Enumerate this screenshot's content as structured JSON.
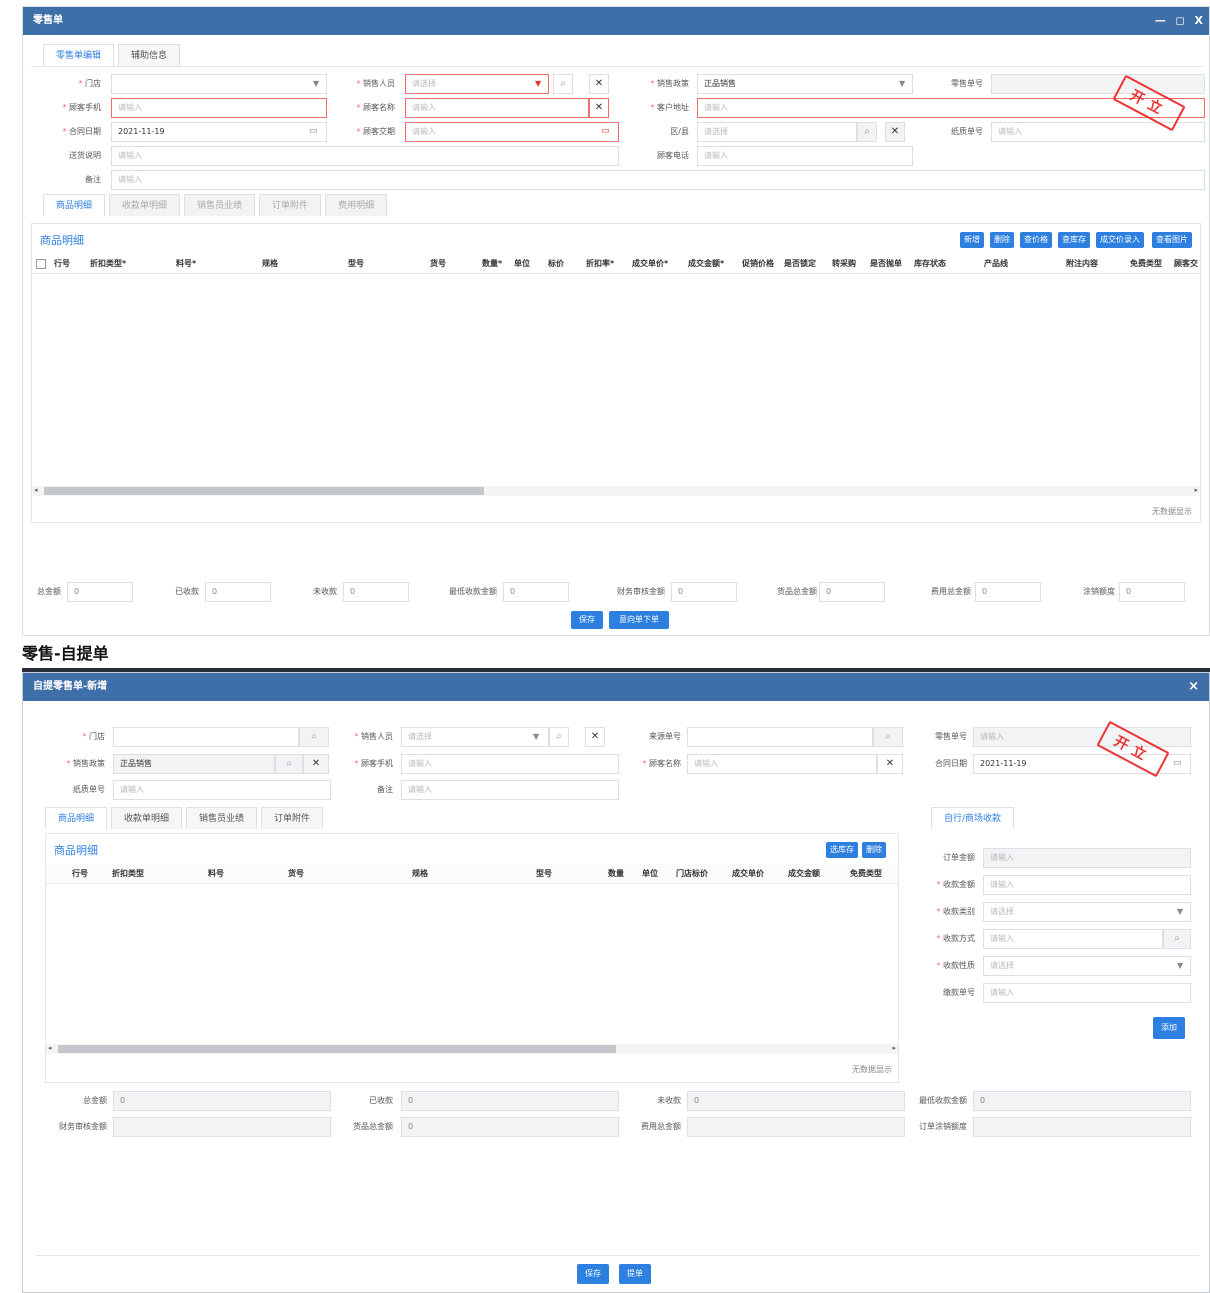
{
  "win1": {
    "title": "零售单",
    "controls": [
      "—",
      "◻",
      "X"
    ],
    "tabs": [
      "零售单编辑",
      "辅助信息"
    ],
    "form": {
      "store_label": "门店",
      "store_value": "",
      "salesperson_label": "销售人员",
      "salesperson_ph": "请选择",
      "policy_label": "销售政策",
      "policy_value": "正品销售",
      "order_no_label": "零售单号",
      "order_no_value": "",
      "phone_label": "顾客手机",
      "phone_ph": "请输入",
      "cust_name_label": "顾客名称",
      "cust_name_ph": "请输入",
      "addr_label": "客户地址",
      "addr_ph": "请输入",
      "contract_label": "合同日期",
      "contract_value": "2021-11-19",
      "delivery_label": "顾客交期",
      "delivery_ph": "请输入",
      "region_label": "区/县",
      "region_ph": "请选择",
      "paper_label": "纸质单号",
      "paper_ph": "请输入",
      "ship_label": "送货说明",
      "ship_ph": "请输入",
      "cphone_label": "顾客电话",
      "cphone_ph": "请输入",
      "remark_label": "备注",
      "remark_ph": "请输入"
    },
    "stamp": "开立",
    "subtabs": [
      "商品明细",
      "收款单明细",
      "销售员业绩",
      "订单附件",
      "费用明细"
    ],
    "section_title": "商品明细",
    "buttons": [
      "新增",
      "删除",
      "查价格",
      "查库存",
      "成交价录入",
      "查看图片"
    ],
    "columns": [
      "行号",
      "折扣类型*",
      "料号*",
      "规格",
      "型号",
      "货号",
      "数量*",
      "单位",
      "标价",
      "折扣率*",
      "成交单价*",
      "成交金额*",
      "促销价格",
      "是否锁定",
      "转采购",
      "是否抛单",
      "库存状态",
      "产品线",
      "附注内容",
      "免费类型",
      "顾客交"
    ],
    "no_data": "无数据显示",
    "summary": [
      {
        "label": "总金额",
        "value": "0"
      },
      {
        "label": "已收款",
        "value": "0"
      },
      {
        "label": "未收款",
        "value": "0"
      },
      {
        "label": "最低收款金额",
        "value": "0"
      },
      {
        "label": "财务审核金额",
        "value": "0"
      },
      {
        "label": "货品总金额",
        "value": "0"
      },
      {
        "label": "费用总金额",
        "value": "0"
      },
      {
        "label": "涂销额度",
        "value": "0"
      }
    ],
    "save": "保存",
    "submit": "意向单下单"
  },
  "heading": "零售-自提单",
  "win2": {
    "title": "自提零售单-新增",
    "close": "×",
    "form": {
      "store_label": "门店",
      "salesperson_label": "销售人员",
      "salesperson_ph": "请选择",
      "source_label": "来源单号",
      "order_no_label": "零售单号",
      "order_no_ph": "请输入",
      "policy_label": "销售政策",
      "policy_value": "正品销售",
      "phone_label": "顾客手机",
      "phone_ph": "请输入",
      "cust_name_label": "顾客名称",
      "cust_name_ph": "请输入",
      "contract_label": "合同日期",
      "contract_value": "2021-11-19",
      "paper_label": "纸质单号",
      "paper_ph": "请输入",
      "remark_label": "备注",
      "remark_ph": "请输入"
    },
    "stamp": "开立",
    "subtabs": [
      "商品明细",
      "收款单明细",
      "销售员业绩",
      "订单附件"
    ],
    "section_title": "商品明细",
    "buttons": [
      "选库存",
      "删除"
    ],
    "columns": [
      "行号",
      "折扣类型",
      "料号",
      "货号",
      "规格",
      "型号",
      "数量",
      "单位",
      "门店标价",
      "成交单价",
      "成交金额",
      "免费类型"
    ],
    "no_data": "无数据显示",
    "payment": {
      "tab": "自行/商场收款",
      "order_amount_label": "订单金额",
      "order_amount_ph": "请输入",
      "pay_amount_label": "收款金额",
      "pay_amount_ph": "请输入",
      "pay_type_label": "收款类别",
      "pay_type_ph": "请选择",
      "pay_method_label": "收款方式",
      "pay_method_ph": "请输入",
      "pay_nature_label": "收款性质",
      "pay_nature_ph": "请选择",
      "ref_label": "缴款单号",
      "ref_ph": "请输入",
      "add": "添加"
    },
    "summary": [
      {
        "label": "总金额",
        "value": "0"
      },
      {
        "label": "已收款",
        "value": "0"
      },
      {
        "label": "未收款",
        "value": "0"
      },
      {
        "label": "最低收款金额",
        "value": "0"
      },
      {
        "label": "财务审核金额",
        "value": ""
      },
      {
        "label": "货品总金额",
        "value": "0"
      },
      {
        "label": "费用总金额",
        "value": ""
      },
      {
        "label": "订单涂销额度",
        "value": ""
      }
    ],
    "save": "保存",
    "submit": "提单"
  }
}
